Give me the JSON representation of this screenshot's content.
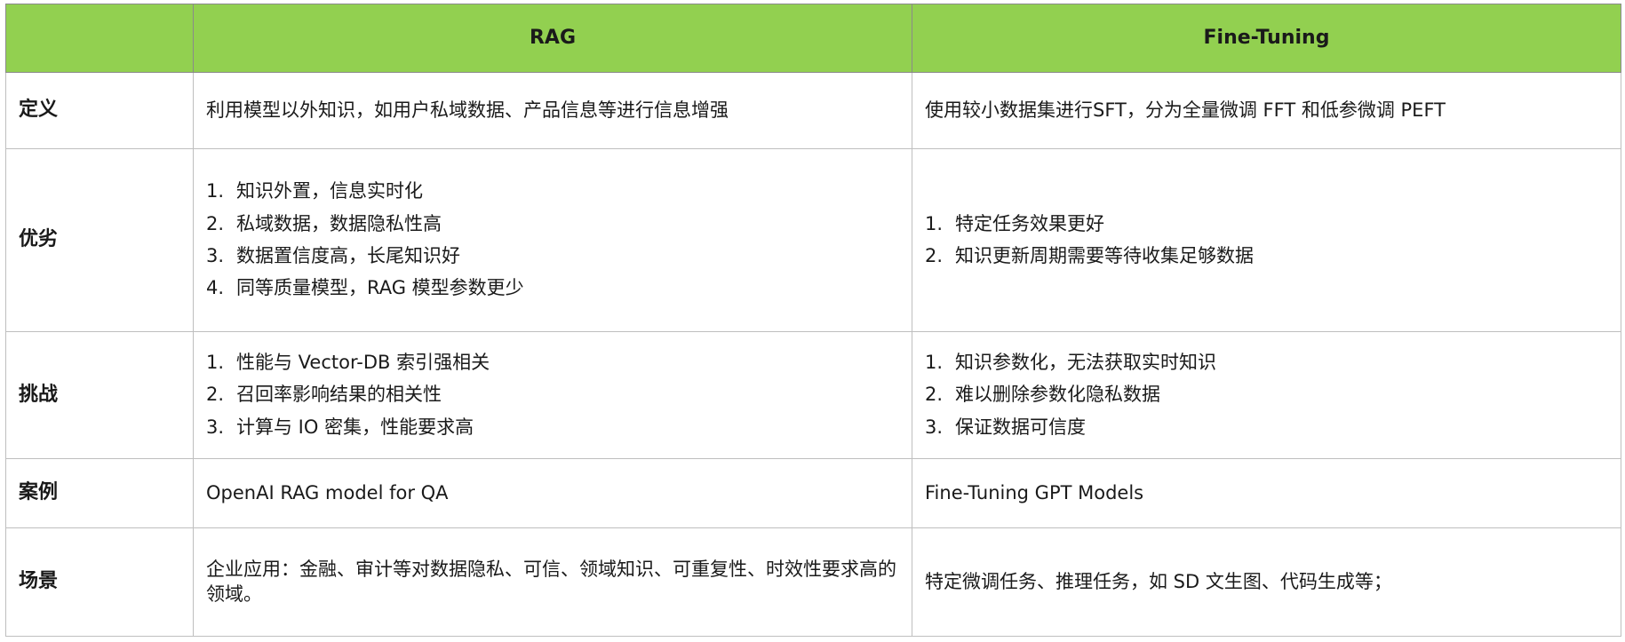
{
  "table": {
    "headers": [
      "",
      "RAG",
      "Fine-Tuning"
    ],
    "rows": [
      {
        "label": "定义",
        "rag": {
          "text": "利用模型以外知识，如用户私域数据、产品信息等进行信息增强"
        },
        "ft": {
          "text": "使用较小数据集进行SFT，分为全量微调 FFT 和低参微调 PEFT"
        }
      },
      {
        "label": "优劣",
        "rag": {
          "items": [
            {
              "num": "1.",
              "text": "知识外置，信息实时化"
            },
            {
              "num": "2.",
              "text": "私域数据，数据隐私性高"
            },
            {
              "num": "3.",
              "text": "数据置信度高，长尾知识好"
            },
            {
              "num": "4.",
              "text": "同等质量模型，RAG 模型参数更少"
            }
          ]
        },
        "ft": {
          "items": [
            {
              "num": "1.",
              "text": "特定任务效果更好"
            },
            {
              "num": "2.",
              "text": "知识更新周期需要等待收集足够数据"
            }
          ]
        }
      },
      {
        "label": "挑战",
        "rag": {
          "items": [
            {
              "num": "1.",
              "text": "性能与 Vector-DB 索引强相关"
            },
            {
              "num": "2.",
              "text": "召回率影响结果的相关性"
            },
            {
              "num": "3.",
              "text": "计算与 IO 密集，性能要求高"
            }
          ]
        },
        "ft": {
          "items": [
            {
              "num": "1.",
              "text": "知识参数化，无法获取实时知识"
            },
            {
              "num": "2.",
              "text": "难以删除参数化隐私数据"
            },
            {
              "num": "3.",
              "text": "保证数据可信度"
            }
          ]
        }
      },
      {
        "label": "案例",
        "rag": {
          "text": "OpenAI RAG model for QA"
        },
        "ft": {
          "text": "Fine-Tuning GPT Models"
        }
      },
      {
        "label": "场景",
        "rag": {
          "text": "企业应用：金融、审计等对数据隐私、可信、领域知识、可重复性、时效性要求高的领域。"
        },
        "ft": {
          "text": "特定微调任务、推理任务，如 SD 文生图、代码生成等；"
        }
      }
    ]
  },
  "colors": {
    "header_bg": "#92d050",
    "border": "#bfbfbf"
  }
}
